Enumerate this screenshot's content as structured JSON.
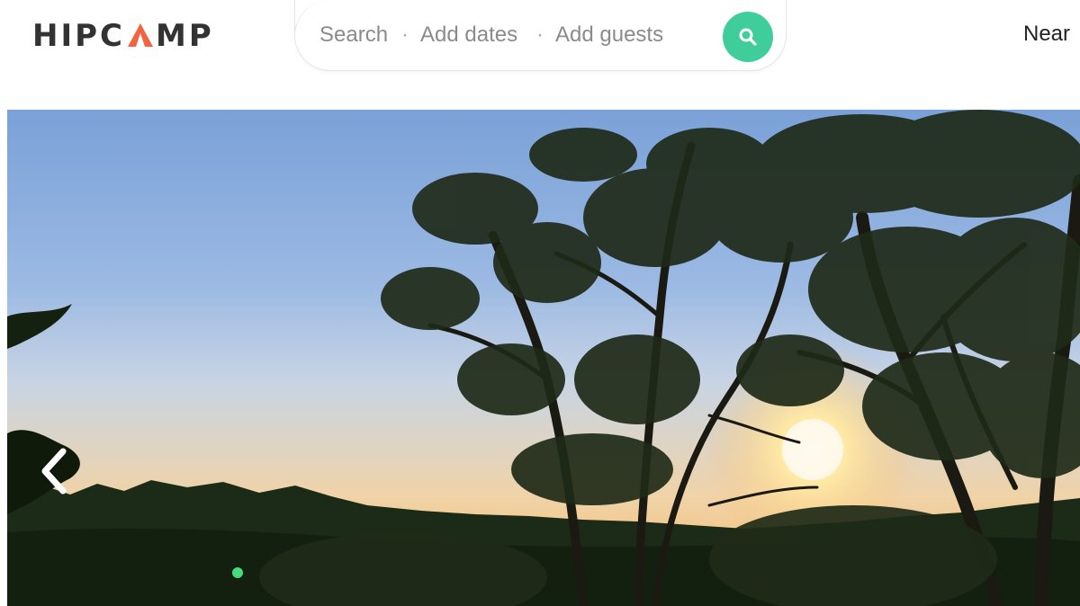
{
  "header": {
    "logo": {
      "part1": "HIPC",
      "part2": "MP",
      "accent_color": "#f26440"
    },
    "search": {
      "field_search": "Search",
      "separator": "·",
      "field_dates": "Add dates",
      "field_guests": "Add guests",
      "button_icon": "search-icon",
      "button_color": "#3fce9b"
    },
    "nav_near": "Near"
  },
  "hero": {
    "prev_icon": "chevron-left-icon"
  }
}
